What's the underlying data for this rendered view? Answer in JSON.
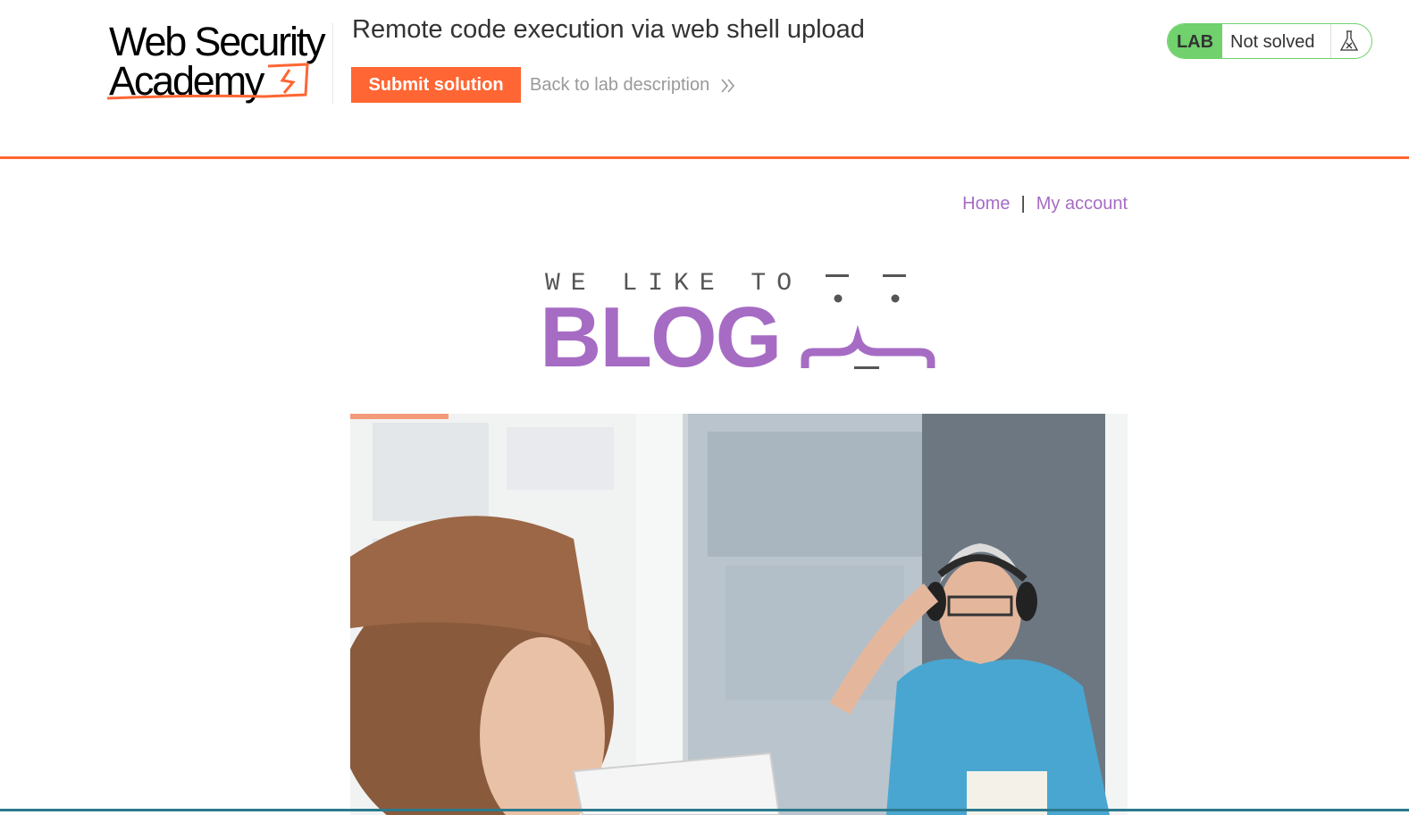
{
  "academy": {
    "logo_line1": "Web Security",
    "logo_line2": "Academy",
    "lab_title": "Remote code execution via web shell upload",
    "submit_label": "Submit solution",
    "back_label": "Back to lab description",
    "status_badge": "LAB",
    "status_text": "Not solved",
    "accent_color": "#ff6633",
    "status_color": "#70d16d",
    "icons": [
      "academy-logo-mark",
      "double-chevron-right-icon",
      "flask-icon"
    ]
  },
  "blog": {
    "nav": {
      "home": "Home",
      "separator": "|",
      "my_account": "My account"
    },
    "banner_tagline": "WE LIKE TO",
    "banner_word": "BLOG",
    "link_color": "#a66cc4",
    "hero_image": "blog post photo: woman facing man wearing headphones behind glass (hearing test)"
  }
}
